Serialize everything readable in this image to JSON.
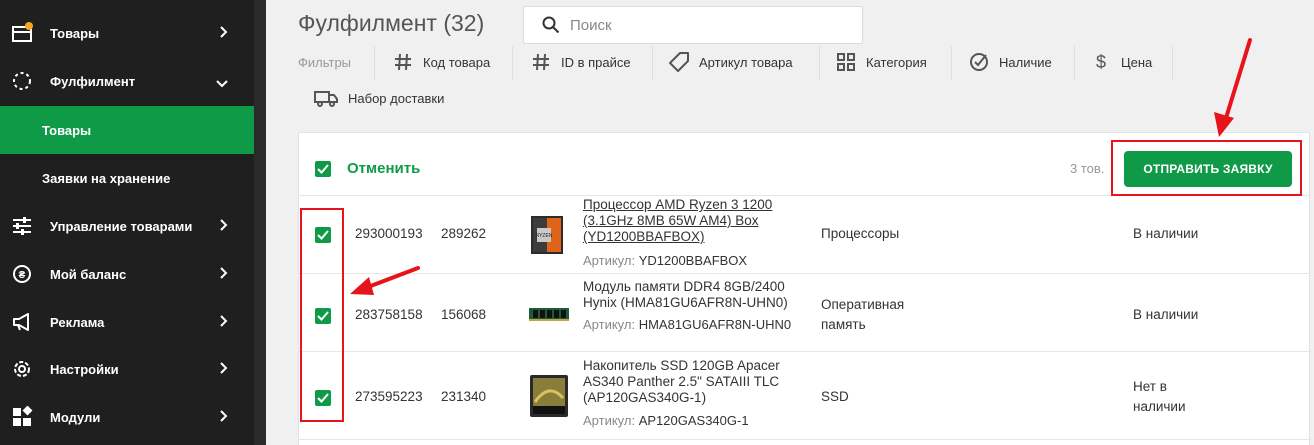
{
  "sidebar": {
    "items": [
      {
        "label": "Товары",
        "icon": "box-icon"
      },
      {
        "label": "Фулфилмент",
        "icon": "dotted-circle-icon"
      },
      {
        "label": "Управление товарами",
        "icon": "sliders-icon"
      },
      {
        "label": "Мой баланс",
        "icon": "coin-icon"
      },
      {
        "label": "Реклама",
        "icon": "megaphone-icon"
      },
      {
        "label": "Настройки",
        "icon": "gear-icon"
      },
      {
        "label": "Модули",
        "icon": "modules-icon"
      }
    ],
    "subitems": [
      {
        "label": "Товары",
        "active": true
      },
      {
        "label": "Заявки на хранение",
        "active": false
      }
    ]
  },
  "header": {
    "title": "Фулфилмент (32)",
    "search_placeholder": "Поиск"
  },
  "filters": {
    "label": "Фильтры",
    "items": [
      {
        "label": "Код товара",
        "icon": "hash-icon"
      },
      {
        "label": "ID в прайсе",
        "icon": "hash-icon"
      },
      {
        "label": "Артикул товара",
        "icon": "tag-icon"
      },
      {
        "label": "Категория",
        "icon": "grid-icon"
      },
      {
        "label": "Наличие",
        "icon": "check-circle-icon"
      },
      {
        "label": "Цена",
        "icon": "dollar-icon"
      },
      {
        "label": "Набор доставки",
        "icon": "truck-icon"
      }
    ]
  },
  "table": {
    "cancel_label": "Отменить",
    "count": "3 тов.",
    "send_label": "ОТПРАВИТЬ ЗАЯВКУ",
    "rows": [
      {
        "code": "293000193",
        "price_id": "289262",
        "name_lines": [
          "Процессор AMD Ryzen 3 1200",
          "(3.1GHz 8MB 65W AM4) Box",
          "(YD1200BBAFBOX)"
        ],
        "article_label": "Артикул:",
        "article": "YD1200BBAFBOX",
        "category_lines": [
          "Процессоры"
        ],
        "availability_lines": [
          "В наличии"
        ],
        "checked": true
      },
      {
        "code": "283758158",
        "price_id": "156068",
        "name_lines": [
          "Модуль памяти DDR4 8GB/2400",
          "Hynix (HMA81GU6AFR8N-UHN0)"
        ],
        "article_label": "Артикул:",
        "article": "HMA81GU6AFR8N-UHN0",
        "category_lines": [
          "Оперативная",
          "память"
        ],
        "availability_lines": [
          "В наличии"
        ],
        "checked": true
      },
      {
        "code": "273595223",
        "price_id": "231340",
        "name_lines": [
          "Накопитель SSD 120GB Apacer",
          "AS340 Panther 2.5\" SATAIII TLC",
          "(AP120GAS340G-1)"
        ],
        "article_label": "Артикул:",
        "article": "AP120GAS340G-1",
        "category_lines": [
          "SSD"
        ],
        "availability_lines": [
          "Нет в",
          "наличии"
        ],
        "checked": true
      }
    ]
  },
  "colors": {
    "accent": "#0f9a47",
    "sidebar_bg": "#1f1f1f",
    "annotation": "#e8141b"
  }
}
